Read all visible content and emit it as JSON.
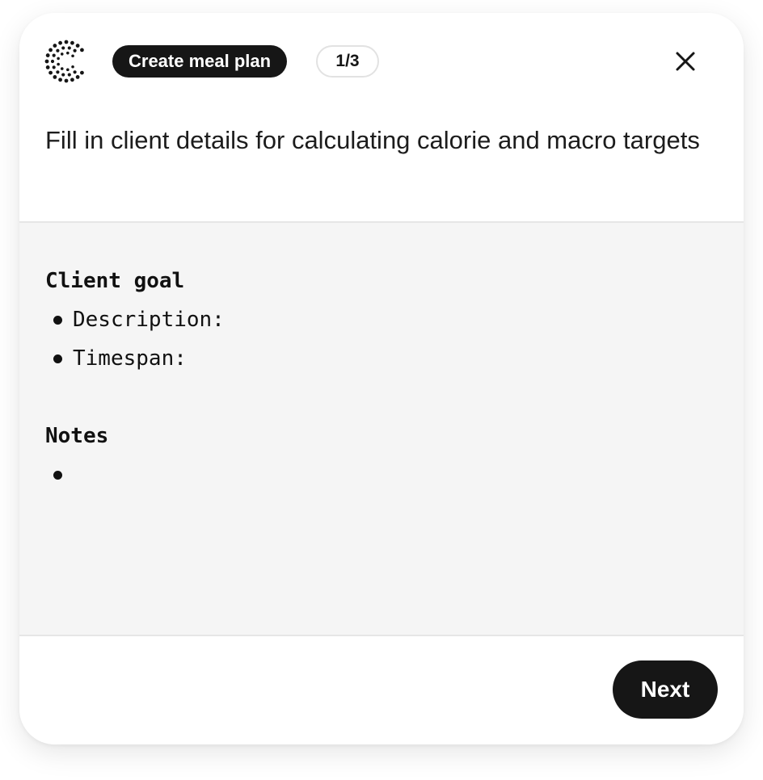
{
  "header": {
    "title_pill": "Create meal plan",
    "step_pill": "1/3",
    "subtitle": "Fill in client details for calculating calorie and macro targets"
  },
  "icons": {
    "logo": "dotted-c-logo-icon",
    "close": "close-icon"
  },
  "body": {
    "client_goal": {
      "title": "Client goal",
      "items": [
        "Description:",
        "Timespan:"
      ]
    },
    "notes": {
      "title": "Notes",
      "items": [
        ""
      ]
    }
  },
  "footer": {
    "next_label": "Next"
  },
  "colors": {
    "dark": "#161616",
    "body_bg": "#f5f5f5",
    "divider": "#e6e6e6"
  }
}
